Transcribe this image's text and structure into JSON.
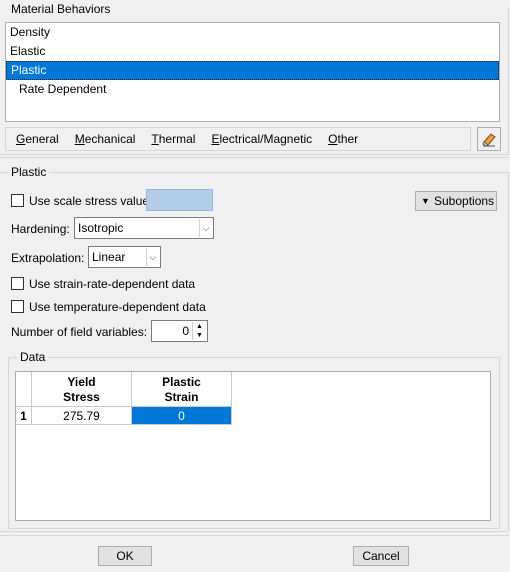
{
  "material_behaviors": {
    "title": "Material Behaviors",
    "items": [
      {
        "label": "Density"
      },
      {
        "label": "Elastic"
      },
      {
        "label": "Plastic"
      },
      {
        "label": "Rate Dependent"
      }
    ],
    "selected": "Plastic"
  },
  "menu": {
    "items": [
      "General",
      "Mechanical",
      "Thermal",
      "Electrical/Magnetic",
      "Other"
    ],
    "mnemonics": [
      "G",
      "M",
      "T",
      "E",
      "O"
    ],
    "tool_icon": "eraser-icon"
  },
  "plastic": {
    "title": "Plastic",
    "use_scale_stress_label": "Use scale stress value:",
    "use_scale_stress_checked": false,
    "suboptions_label": "Suboptions",
    "hardening_label": "Hardening:",
    "hardening_value": "Isotropic",
    "extrapolation_label": "Extrapolation:",
    "extrapolation_value": "Linear",
    "strain_rate_label": "Use strain-rate-dependent data",
    "strain_rate_checked": false,
    "temperature_label": "Use temperature-dependent data",
    "temperature_checked": false,
    "field_vars_label": "Number of field variables:",
    "field_vars_value": "0"
  },
  "data": {
    "title": "Data",
    "columns": [
      {
        "line1": "Yield",
        "line2": "Stress"
      },
      {
        "line1": "Plastic",
        "line2": "Strain"
      }
    ],
    "rows": [
      {
        "index": "1",
        "cells": [
          "275.79",
          "0"
        ]
      }
    ]
  },
  "footer": {
    "ok_label": "OK",
    "cancel_label": "Cancel"
  },
  "colors": {
    "selection": "#0078d7",
    "disabled_input": "#b3cde8"
  }
}
